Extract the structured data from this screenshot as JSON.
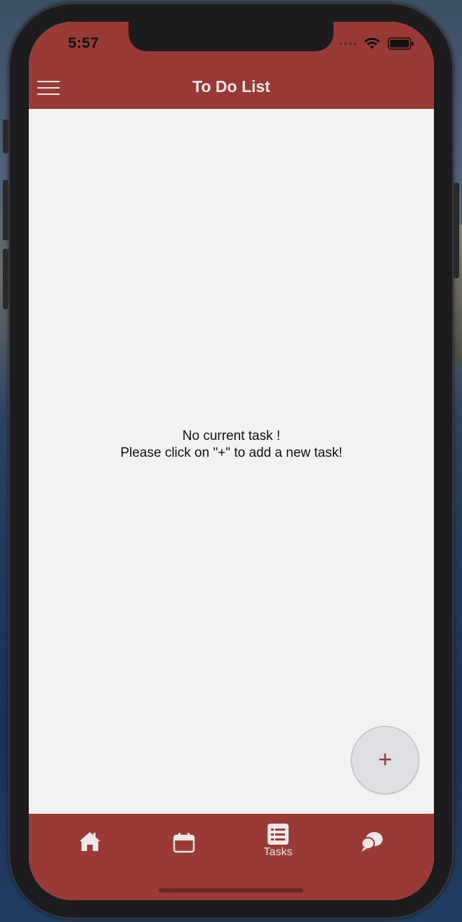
{
  "status_bar": {
    "time": "5:57"
  },
  "header": {
    "title": "To Do List",
    "menu_icon": "hamburger-menu-icon"
  },
  "main": {
    "empty_line1": "No current task !",
    "empty_line2": "Please click on \"+\" to add a new task!"
  },
  "fab": {
    "label": "+"
  },
  "tabbar": {
    "tabs": [
      {
        "icon": "home-icon",
        "label": ""
      },
      {
        "icon": "calendar-icon",
        "label": ""
      },
      {
        "icon": "list-icon",
        "label": "Tasks"
      },
      {
        "icon": "chat-icon",
        "label": ""
      }
    ]
  },
  "colors": {
    "accent": "#9a3a37",
    "background": "#f2f2f2",
    "fab_background": "#dfe0e3"
  }
}
